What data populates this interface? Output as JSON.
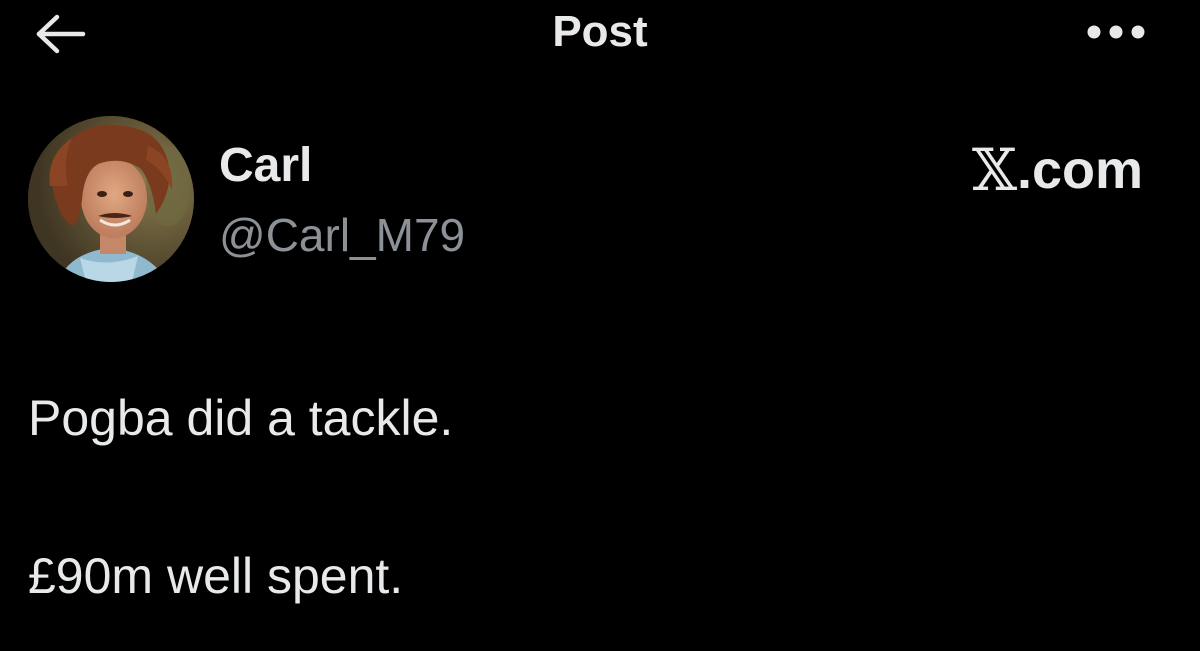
{
  "header": {
    "title": "Post",
    "back_icon": "arrow-left-icon",
    "more_icon": "more-horizontal-icon"
  },
  "post": {
    "author": {
      "display_name": "Carl",
      "handle": "@Carl_M79",
      "avatar": "profile-photo"
    },
    "text_lines": [
      "Pogba did a tackle.",
      "£90m well spent."
    ]
  },
  "watermark": {
    "logo": "𝕏",
    "domain": ".com"
  },
  "colors": {
    "background": "#000000",
    "primary_text": "#e7e9ea",
    "secondary_text": "#8b9197"
  }
}
